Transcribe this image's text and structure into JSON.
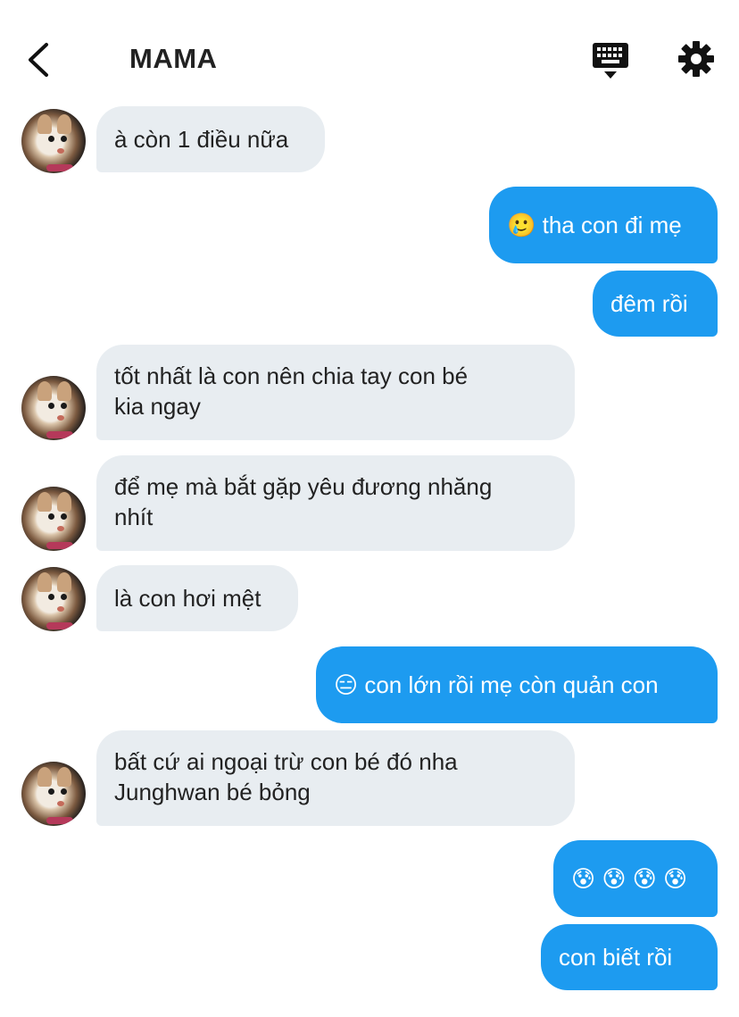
{
  "header": {
    "title": "MAMA"
  },
  "messages": [
    {
      "side": "in",
      "text": "à còn 1 điều nữa"
    },
    {
      "side": "out",
      "text": "🥲 tha con đi mẹ"
    },
    {
      "side": "out",
      "text": "đêm rồi"
    },
    {
      "side": "in",
      "text": "tốt nhất là con nên chia tay con bé\nkia ngay"
    },
    {
      "side": "in",
      "text": "để mẹ mà bắt gặp yêu đương nhăng\nnhít"
    },
    {
      "side": "in",
      "text": "là con hơi mệt"
    },
    {
      "side": "out",
      "text": "😑 con lớn rồi mẹ còn quản con"
    },
    {
      "side": "in",
      "text": "bất cứ ai ngoại trừ con bé đó nha\nJunghwan bé bỏng"
    },
    {
      "side": "out",
      "text": "😰 😰 😰 😰"
    },
    {
      "side": "out",
      "text": "con biết rồi"
    }
  ],
  "colors": {
    "outgoing_bubble": "#1d9bf0",
    "incoming_bubble": "#e8edf1"
  },
  "icons": [
    "back-arrow-icon",
    "keyboard-icon",
    "gear-icon",
    "avatar"
  ]
}
